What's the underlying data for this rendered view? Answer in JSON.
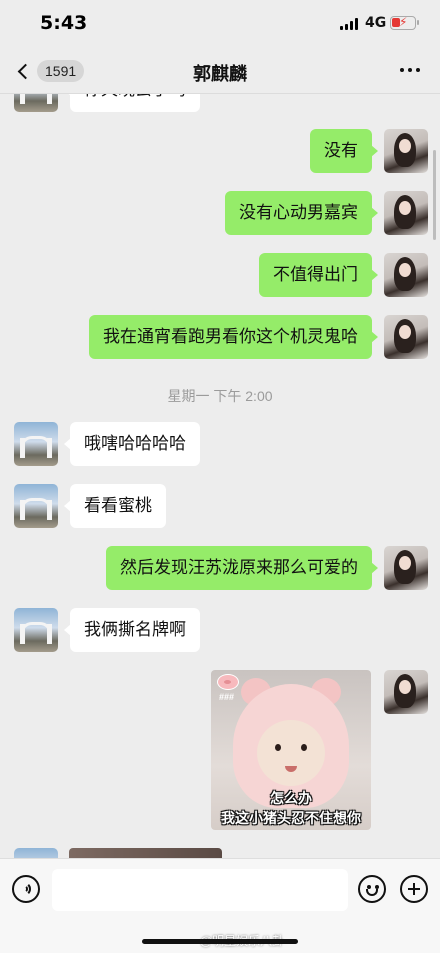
{
  "status_bar": {
    "time": "5:43",
    "network": "4G",
    "battery_color": "#e53935"
  },
  "nav": {
    "unread_count": "1591",
    "title": "郭麒麟"
  },
  "messages": [
    {
      "side": "other",
      "text": "你天晓去了吗"
    },
    {
      "side": "me",
      "text": "没有"
    },
    {
      "side": "me",
      "text": "没有心动男嘉宾"
    },
    {
      "side": "me",
      "text": "不值得出门"
    },
    {
      "side": "me",
      "text": "我在通宵看跑男看你这个机灵鬼哈"
    },
    {
      "side": "other",
      "text": "哦嗐哈哈哈哈"
    },
    {
      "side": "other",
      "text": "看看蜜桃"
    },
    {
      "side": "me",
      "text": "然后发现汪苏泷原来那么可爱的"
    },
    {
      "side": "other",
      "text": "我俩撕名牌啊"
    }
  ],
  "timestamp": "星期一 下午 2:00",
  "sticker": {
    "caption_line1": "怎么办",
    "caption_line2": "我这小猪头忍不住想你",
    "pig_tag": "###"
  },
  "input_bar": {
    "placeholder": ""
  },
  "watermark": "@明星娱乐八卦",
  "colors": {
    "my_bubble": "#95ec69",
    "their_bubble": "#ffffff",
    "background": "#ededed"
  },
  "icons": [
    "voice-icon",
    "emoji-icon",
    "plus-icon",
    "back-chevron-icon",
    "more-icon"
  ]
}
